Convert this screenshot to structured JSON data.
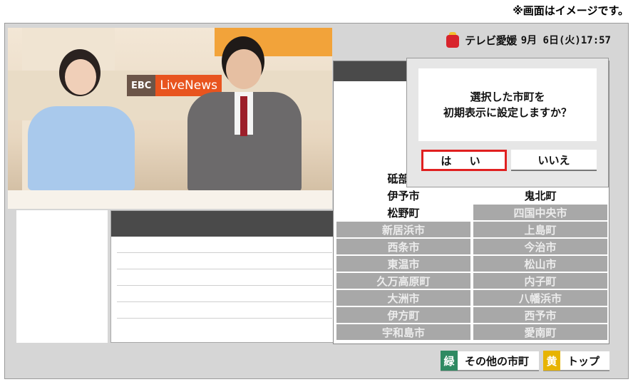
{
  "note": "※画面はイメージです。",
  "header": {
    "brand": "テレビ愛媛",
    "date": "9月 6日(火)17:57"
  },
  "video": {
    "logo_left": "EBC",
    "logo_right": "LiveNews"
  },
  "dialog": {
    "line1": "選択した市町を",
    "line2": "初期表示に設定しますか？",
    "yes": "は い",
    "no": "いいえ"
  },
  "cities": [
    {
      "name": "砥部町",
      "state": "white"
    },
    {
      "name": "",
      "state": "white"
    },
    {
      "name": "伊予市",
      "state": "white"
    },
    {
      "name": "鬼北町",
      "state": "white"
    },
    {
      "name": "松野町",
      "state": "white"
    },
    {
      "name": "四国中央市",
      "state": "gray"
    },
    {
      "name": "新居浜市",
      "state": "gray"
    },
    {
      "name": "上島町",
      "state": "gray"
    },
    {
      "name": "西条市",
      "state": "gray"
    },
    {
      "name": "今治市",
      "state": "gray"
    },
    {
      "name": "東温市",
      "state": "gray"
    },
    {
      "name": "松山市",
      "state": "gray"
    },
    {
      "name": "久万高原町",
      "state": "gray"
    },
    {
      "name": "内子町",
      "state": "gray"
    },
    {
      "name": "大洲市",
      "state": "gray"
    },
    {
      "name": "八幡浜市",
      "state": "gray"
    },
    {
      "name": "伊方町",
      "state": "gray"
    },
    {
      "name": "西予市",
      "state": "gray"
    },
    {
      "name": "宇和島市",
      "state": "gray"
    },
    {
      "name": "愛南町",
      "state": "gray"
    }
  ],
  "footer": {
    "green_key": "緑",
    "green_label": "その他の市町",
    "yellow_key": "黄",
    "yellow_label": "トップ"
  },
  "colors": {
    "yes_border": "#e02020",
    "green": "#2e8a62",
    "yellow": "#e7b400"
  }
}
